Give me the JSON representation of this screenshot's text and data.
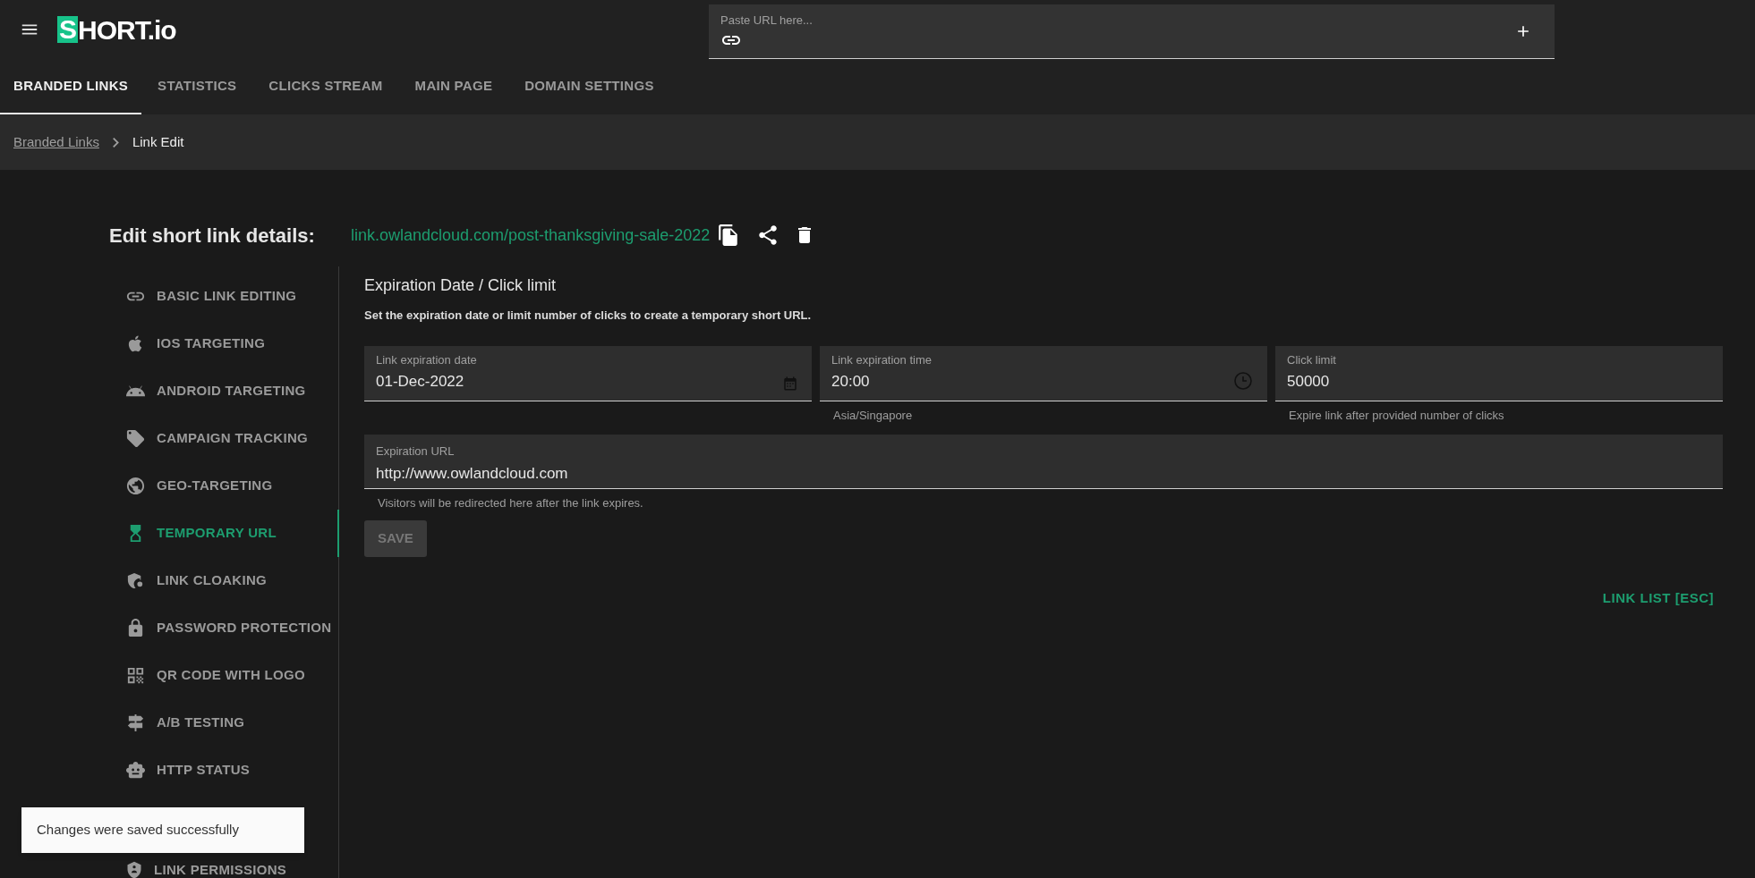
{
  "header": {
    "logo": "SHORT.io",
    "url_field": {
      "placeholder": "Paste URL here..."
    }
  },
  "tabs": [
    {
      "label": "BRANDED LINKS",
      "selected": true
    },
    {
      "label": "STATISTICS",
      "selected": false
    },
    {
      "label": "CLICKS STREAM",
      "selected": false
    },
    {
      "label": "MAIN PAGE",
      "selected": false
    },
    {
      "label": "DOMAIN SETTINGS",
      "selected": false
    }
  ],
  "breadcrumb": {
    "parent": "Branded Links",
    "current": "Link Edit"
  },
  "page_title": "Edit short link details:",
  "short_link": "link.owlandcloud.com/post-thanksgiving-sale-2022",
  "sidebar": {
    "items": [
      {
        "label": "BASIC LINK EDITING",
        "selected": false
      },
      {
        "label": "IOS TARGETING",
        "selected": false
      },
      {
        "label": "ANDROID TARGETING",
        "selected": false
      },
      {
        "label": "CAMPAIGN TRACKING",
        "selected": false
      },
      {
        "label": "GEO-TARGETING",
        "selected": false
      },
      {
        "label": "TEMPORARY URL",
        "selected": true
      },
      {
        "label": "LINK CLOAKING",
        "selected": false
      },
      {
        "label": "PASSWORD PROTECTION",
        "selected": false
      },
      {
        "label": "QR CODE WITH LOGO",
        "selected": false
      },
      {
        "label": "A/B TESTING",
        "selected": false
      },
      {
        "label": "HTTP STATUS",
        "selected": false
      },
      {
        "label": "LINK PERMISSIONS",
        "selected": false
      }
    ]
  },
  "section": {
    "title": "Expiration Date / Click limit",
    "description": "Set the expiration date or limit number of clicks to create a temporary short URL.",
    "fields": [
      {
        "label": "Link expiration date",
        "value": "01-Dec-2022",
        "kind": "date"
      },
      {
        "label": "Link expiration time",
        "value": "20:00",
        "helper": "Asia/Singapore",
        "kind": "time"
      },
      {
        "label": "Click limit",
        "value": "50000",
        "helper": "Expire link after provided number of clicks",
        "kind": "text"
      }
    ],
    "url_field": {
      "label": "Expiration URL",
      "value": "http://www.owlandcloud.com",
      "helper": "Visitors will be redirected here after the link expires."
    },
    "save_button": {
      "label": "SAVE",
      "disabled": true
    }
  },
  "link_list_button": "LINK LIST [ESC]",
  "toast": "Changes were saved successfully"
}
